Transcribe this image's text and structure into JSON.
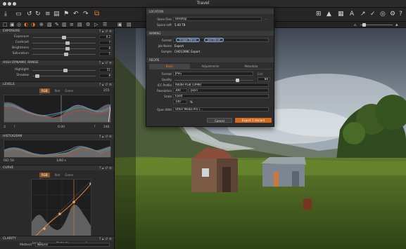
{
  "window": {
    "title": "Travel"
  },
  "toolbar": {
    "right_icons": [
      "grid-icon",
      "warning-icon",
      "grid-small-icon",
      "text-icon",
      "cursor-icon",
      "checkmark-icon",
      "circle-icon",
      "gear-icon",
      "help-icon"
    ]
  },
  "left_panel": {
    "exposure": {
      "title": "EXPOSURE",
      "rows": [
        {
          "label": "Exposure",
          "value": "0.2",
          "level": 0.5
        },
        {
          "label": "Contrast",
          "value": "7",
          "level": 0.55
        },
        {
          "label": "Brightness",
          "value": "8",
          "level": 0.56
        },
        {
          "label": "Saturation",
          "value": "5",
          "level": 0.53
        }
      ]
    },
    "hdr": {
      "title": "HIGH DYNAMIC RANGE",
      "rows": [
        {
          "label": "Highlight",
          "value": "51",
          "level": 0.52
        },
        {
          "label": "Shadow",
          "value": "8",
          "level": 0.08
        }
      ]
    },
    "levels": {
      "title": "LEVELS",
      "tabs": [
        "RGB",
        "Red",
        "Green",
        "Blue"
      ],
      "active_tab": "RGB",
      "top_value": "255",
      "low_value": "3",
      "mid_value": "0.00",
      "high_value": "246"
    },
    "histogram": {
      "title": "HISTOGRAM",
      "info_left": "ISO 50",
      "info_mid": "1/60 s"
    },
    "curve": {
      "title": "CURVE",
      "tabs": [
        "RGB",
        "Red",
        "Green",
        "Blue"
      ],
      "active_tab": "RGB",
      "input_label": "Input:",
      "input_value": "—",
      "output_label": "Output:",
      "output_value": "—"
    },
    "clarity": {
      "title": "CLARITY",
      "method_label": "Method",
      "method_value": "Natural"
    }
  },
  "dialog": {
    "location": {
      "header": "LOCATION",
      "store_label": "Store Files",
      "store_value": "Desktop",
      "space_label": "Space Left",
      "space_value": "5.40 TB"
    },
    "naming": {
      "header": "NAMING",
      "format_label": "Format",
      "format_tokens": [
        "Image Name",
        "Job Name"
      ],
      "jobname_label": "Job Name",
      "jobname_value": "Export",
      "sample_label": "Sample",
      "sample_value": "CHO1398C Export"
    },
    "recipe": {
      "header": "RECIPE",
      "tabs": [
        "Basic",
        "Adjustments",
        "Metadata"
      ],
      "active_tab": "Basic",
      "format_label": "Format",
      "format_value": "JPEG",
      "edit_label": "Edit",
      "quality_label": "Quality",
      "quality_value": "80",
      "quality_level": 0.8,
      "icc_label": "ICC Profile",
      "icc_value": "Adobe RGB (1998)",
      "res_label": "Resolution",
      "res_value": "300",
      "res_unit": "px/in",
      "scale_label": "Scale",
      "scale_value": "Fixed",
      "scale_pct": "100",
      "scale_unit": "%",
      "openwith_label": "Open With",
      "openwith_value": "Other Media Pro (..."
    },
    "buttons": {
      "cancel": "Cancel",
      "export": "Export 1 Variant"
    }
  }
}
